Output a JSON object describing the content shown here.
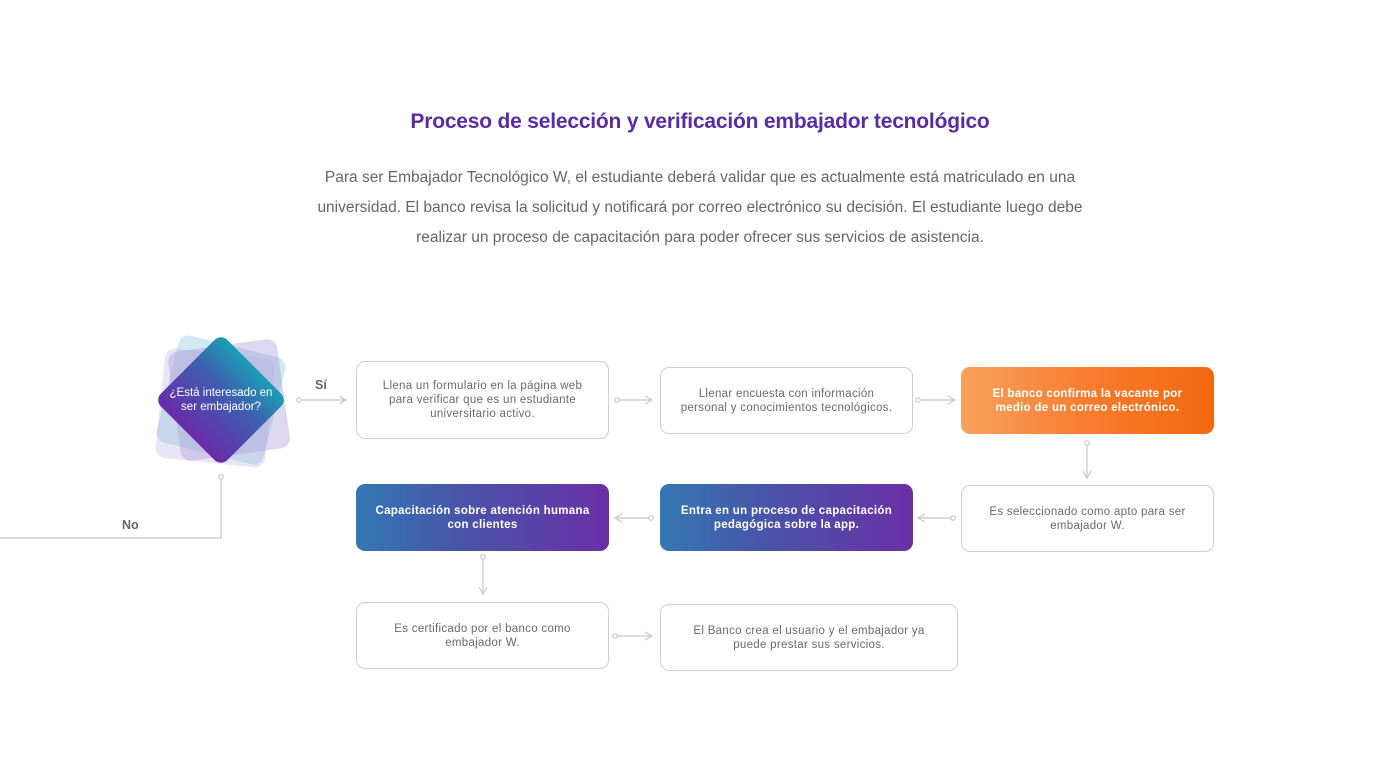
{
  "header": {
    "title": "Proceso de selección y verificación embajador tecnológico",
    "description": "Para ser Embajador Tecnológico W, el estudiante deberá validar que es actualmente está matriculado en una universidad. El banco revisa la solicitud y notificará por correo electrónico su decisión. El estudiante luego debe realizar un proceso de capacitación para poder ofrecer sus servicios de asistencia."
  },
  "flow": {
    "decision": "¿Está interesado en ser embajador?",
    "yes_label": "Sí",
    "no_label": "No",
    "steps": {
      "form": "Llena un formulario en la página web para verificar que es un estudiante universitario activo.",
      "survey": "Llenar encuesta con información personal y conocimientos tecnológicos.",
      "confirm": "El banco confirma la vacante por medio de un correo electrónico.",
      "selected": "Es seleccionado como apto para ser embajador W.",
      "pedagogic": "Entra en un proceso de capacitación pedagógica sobre la app.",
      "human": "Capacitación sobre atención humana con clientes",
      "certified": "Es certificado por el banco como embajador W.",
      "user": "El Banco crea el usuario y el embajador ya puede prestar sus servicios."
    }
  },
  "colors": {
    "title": "#5a2ca0",
    "orange_start": "#f9a15c",
    "orange_end": "#f2680f",
    "purple_start": "#3477b4",
    "purple_end": "#6a30a6",
    "line": "#c8c8c8"
  }
}
